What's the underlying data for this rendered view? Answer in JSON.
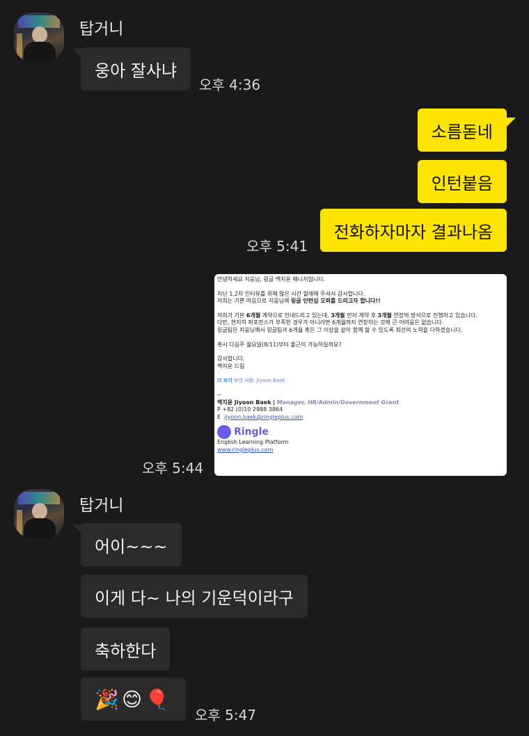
{
  "groups": [
    {
      "sender": "탑거니",
      "messages": [
        {
          "text": "웅아 잘사냐",
          "time": "오후 4:36"
        }
      ]
    },
    {
      "sender": "me",
      "messages": [
        {
          "text": "소름돋네"
        },
        {
          "text": "인턴붙음"
        },
        {
          "text": "전화하자마자 결과나옴",
          "time": "오후 5:41"
        }
      ]
    },
    {
      "sender": "me",
      "image_time": "오후 5:44"
    },
    {
      "sender": "탑거니",
      "messages": [
        {
          "text": "어이~~~"
        },
        {
          "text": "이게 다~ 나의 기운덕이라구"
        },
        {
          "text": "축하한다"
        },
        {
          "text": "🎉😊🎈",
          "time": "오후 5:47"
        }
      ]
    }
  ],
  "email": {
    "greeting": "안녕하세요 지웅님, 링글 백지윤 매니저입니다.",
    "p1_line1": "지난 1,2차 인터뷰를 위해 많은 시간 할애해 주셔서 감사합니다.",
    "p1_line2_pre": "저희는 기쁜 마음으로 지웅님께 ",
    "p1_line2_bold": "링글 인턴십 오퍼를 드리고자 합니다!!",
    "p2_line1_a": "저희가 기본 ",
    "p2_line1_b": "6개월",
    "p2_line1_c": " 계약으로 안내드리고 있는데, ",
    "p2_line1_d": "3개월",
    "p2_line1_e": " 먼저 계약 후 ",
    "p2_line1_f": "3개월",
    "p2_line1_g": " 연장의 방식으로 진행하고 있습니다.",
    "p2_line2": "다만, 현지히 퍼포먼스가 부족한 경우가 아니라면 6개월까지 연장하는 것에 큰 어려움은 없습니다.",
    "p2_line3": "링글팀은 지웅님께서 링글팀과 6개월 혹은 그 이상을 같이 함께 할 수 있도록 최선의 노력을 다하겠습니다.",
    "p3": "혹시 다음주 월요일(8/11)부터 출근이 가능하실까요?",
    "closing1": "감사합니다.",
    "closing2": "백지윤 드림",
    "more_label": "더 보기",
    "more_sender": "보낸 사람: Jiyoon Baek",
    "sig_dash": "--",
    "sig_name": "백지윤 Jiyoon Baek |",
    "sig_role": "Manager, HR/Admin/Government Grant",
    "sig_phone": "P  +82 (0)10 2988 3864",
    "sig_email_label": "E",
    "sig_email": "jiyoon.baek@ringleplus.com",
    "logo_text": "Ringle",
    "platform": "English Learning Platform",
    "website": "www.ringleplus.com"
  }
}
